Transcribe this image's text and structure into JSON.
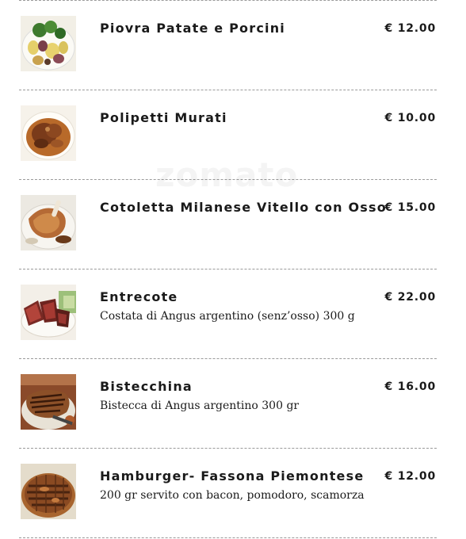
{
  "menu": {
    "items": [
      {
        "name": "Piovra Patate e Porcini",
        "description": "",
        "price": "€ 12.00",
        "thumb_icon": "octopus-potatoes-dish-photo"
      },
      {
        "name": "Polipetti Murati",
        "description": "",
        "price": "€ 10.00",
        "thumb_icon": "stewed-octopus-dish-photo"
      },
      {
        "name": "Cotoletta Milanese Vitello con Osso",
        "description": "",
        "price": "€ 15.00",
        "thumb_icon": "veal-cutlet-dish-photo"
      },
      {
        "name": "Entrecote",
        "description": "Costata di Angus argentino (senz’osso) 300 g",
        "price": "€ 22.00",
        "thumb_icon": "entrecote-dish-photo"
      },
      {
        "name": "Bistecchina",
        "description": "Bistecca di Angus argentino 300 gr",
        "price": "€ 16.00",
        "thumb_icon": "steak-dish-photo"
      },
      {
        "name": "Hamburger- Fassona Piemontese",
        "description": "200 gr servito con bacon, pomodoro, scamorza",
        "price": "€ 12.00",
        "thumb_icon": "hamburger-dish-photo"
      }
    ]
  },
  "watermark": {
    "text": "zomato"
  }
}
